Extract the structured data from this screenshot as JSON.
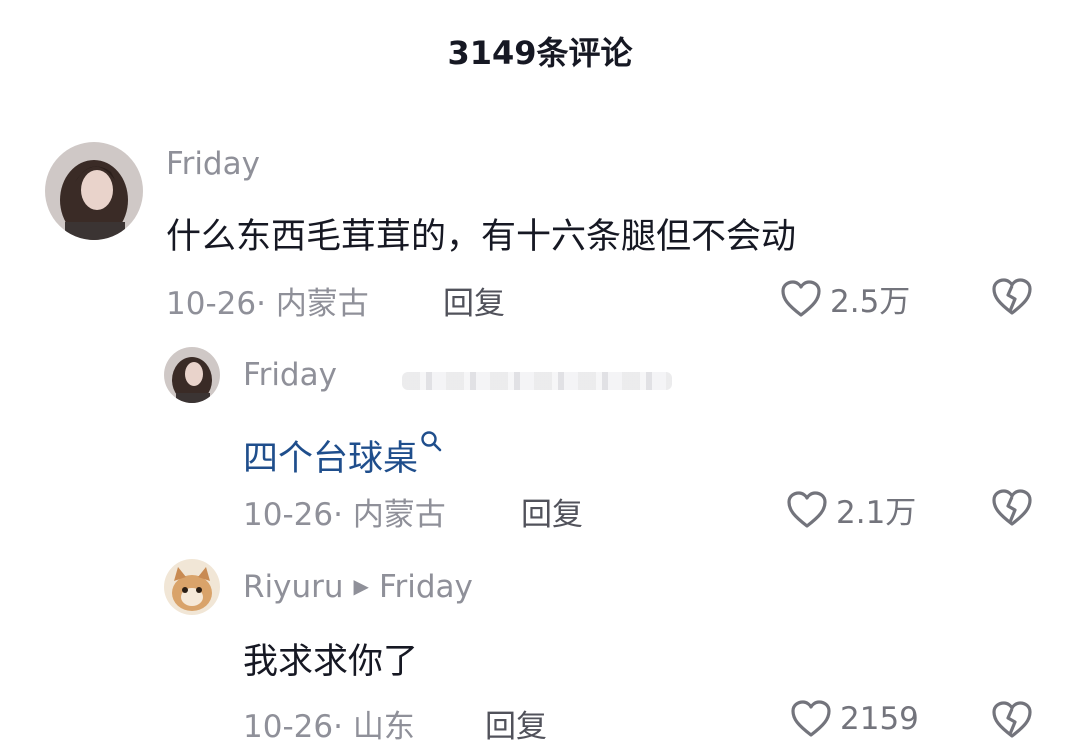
{
  "header": {
    "title": "3149条评论"
  },
  "comments": [
    {
      "username": "Friday",
      "text": "什么东西毛茸茸的，有十六条腿但不会动",
      "date": "10-26",
      "location": "内蒙古",
      "reply_label": "回复",
      "likes": "2.5万",
      "avatar_icon": "avatar-girl"
    },
    {
      "username": "Friday",
      "text": "四个台球桌",
      "date": "10-26",
      "location": "内蒙古",
      "reply_label": "回复",
      "likes": "2.1万",
      "avatar_icon": "avatar-girl"
    },
    {
      "username": "Riyuru",
      "reply_to": "Friday",
      "text": "我求求你了",
      "date": "10-26",
      "location": "山东",
      "reply_label": "回复",
      "likes": "2159",
      "avatar_icon": "avatar-cat"
    }
  ],
  "colors": {
    "text_primary": "#161823",
    "text_secondary": "#8f9099",
    "link": "#1f4e8c"
  }
}
